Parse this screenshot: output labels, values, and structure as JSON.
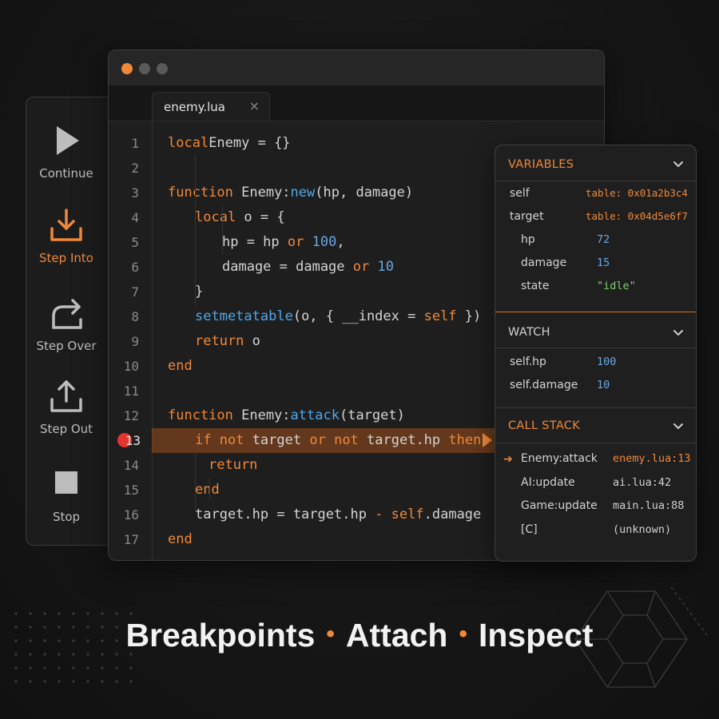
{
  "toolbar": {
    "continue": "Continue",
    "step_into": "Step Into",
    "step_over": "Step Over",
    "step_out": "Step Out",
    "stop": "Stop"
  },
  "editor": {
    "tab": "enemy.lua",
    "close_icon": "×",
    "current_line": 13,
    "breakpoint_line": 13
  },
  "code_lines": [
    {
      "n": "1",
      "indent": 0,
      "tokens": [
        [
          "kw",
          "local"
        ],
        [
          "",
          "Enemy = {}"
        ]
      ]
    },
    {
      "n": "2",
      "indent": 0,
      "tokens": []
    },
    {
      "n": "3",
      "indent": 0,
      "tokens": [
        [
          "kw",
          "function"
        ],
        [
          "",
          " Enemy:"
        ],
        [
          "fn",
          "new"
        ],
        [
          "",
          "(hp, damage)"
        ]
      ]
    },
    {
      "n": "4",
      "indent": 1,
      "tokens": [
        [
          "kw",
          "local"
        ],
        [
          "",
          " o = {"
        ]
      ]
    },
    {
      "n": "5",
      "indent": 2,
      "tokens": [
        [
          "",
          "hp = hp "
        ],
        [
          "kw",
          "or"
        ],
        [
          "",
          " "
        ],
        [
          "num",
          "100"
        ],
        [
          "",
          ","
        ]
      ]
    },
    {
      "n": "6",
      "indent": 2,
      "tokens": [
        [
          "",
          "damage = damage "
        ],
        [
          "kw",
          "or"
        ],
        [
          "",
          " "
        ],
        [
          "num",
          "10"
        ]
      ]
    },
    {
      "n": "7",
      "indent": 1,
      "tokens": [
        [
          "",
          "}"
        ]
      ]
    },
    {
      "n": "8",
      "indent": 1,
      "tokens": [
        [
          "fn",
          "setmetatable"
        ],
        [
          "",
          "(o, { __index = "
        ],
        [
          "kw",
          "self"
        ],
        [
          "",
          " })"
        ]
      ]
    },
    {
      "n": "9",
      "indent": 1,
      "tokens": [
        [
          "kw",
          "return"
        ],
        [
          "",
          " o"
        ]
      ]
    },
    {
      "n": "10",
      "indent": 0,
      "tokens": [
        [
          "kw",
          "end"
        ]
      ]
    },
    {
      "n": "11",
      "indent": 0,
      "tokens": []
    },
    {
      "n": "12",
      "indent": 0,
      "tokens": [
        [
          "kw",
          "function"
        ],
        [
          "",
          " Enemy:"
        ],
        [
          "fn",
          "attack"
        ],
        [
          "",
          "(target)"
        ]
      ]
    },
    {
      "n": "13",
      "indent": 1,
      "tokens": [
        [
          "kw",
          "if"
        ],
        [
          "",
          " "
        ],
        [
          "kw",
          "not"
        ],
        [
          "",
          " target "
        ],
        [
          "kw",
          "or"
        ],
        [
          "",
          " "
        ],
        [
          "kw",
          "not"
        ],
        [
          "",
          " target.hp "
        ],
        [
          "kw",
          "then"
        ]
      ]
    },
    {
      "n": "14",
      "indent": 1.5,
      "tokens": [
        [
          "kw",
          "return"
        ]
      ]
    },
    {
      "n": "15",
      "indent": 1,
      "tokens": [
        [
          "kw",
          "end"
        ]
      ]
    },
    {
      "n": "16",
      "indent": 1,
      "tokens": [
        [
          "",
          "target.hp = target.hp "
        ],
        [
          "op",
          "-"
        ],
        [
          "",
          " "
        ],
        [
          "kw",
          "self"
        ],
        [
          "",
          ".damage"
        ]
      ]
    },
    {
      "n": "17",
      "indent": 0,
      "tokens": [
        [
          "kw",
          "end"
        ]
      ]
    }
  ],
  "variables": {
    "title": "VARIABLES",
    "rows": [
      {
        "name": "self",
        "value": "table: 0x01a2b3c4",
        "type": "table",
        "nested": false
      },
      {
        "name": "target",
        "value": "table: 0x04d5e6f7",
        "type": "table",
        "nested": false
      },
      {
        "name": "hp",
        "value": "72",
        "type": "number",
        "nested": true
      },
      {
        "name": "damage",
        "value": "15",
        "type": "number",
        "nested": true
      },
      {
        "name": "state",
        "value": "\"idle\"",
        "type": "string",
        "nested": true
      }
    ]
  },
  "watch": {
    "title": "WATCH",
    "rows": [
      {
        "name": "self.hp",
        "value": "100"
      },
      {
        "name": "self.damage",
        "value": "10"
      }
    ]
  },
  "call_stack": {
    "title": "CALL STACK",
    "frames": [
      {
        "name": "Enemy:attack",
        "location": "enemy.lua:13",
        "current": true
      },
      {
        "name": "AI:update",
        "location": "ai.lua:42",
        "current": false
      },
      {
        "name": "Game:update",
        "location": "main.lua:88",
        "current": false
      },
      {
        "name": "[C]",
        "location": "(unknown)",
        "current": false
      }
    ]
  },
  "tagline": {
    "word1": "Breakpoints",
    "word2": "Attach",
    "word3": "Inspect",
    "bullet": "•"
  },
  "colors": {
    "accent": "#f0883a",
    "breakpoint": "#e5342f",
    "number": "#6aa6e3",
    "string": "#7ccf6a",
    "background": "#141414"
  },
  "icons": {
    "continue": "play-icon",
    "step_into": "step-into-icon",
    "step_over": "step-over-icon",
    "step_out": "step-out-icon",
    "stop": "stop-icon"
  }
}
